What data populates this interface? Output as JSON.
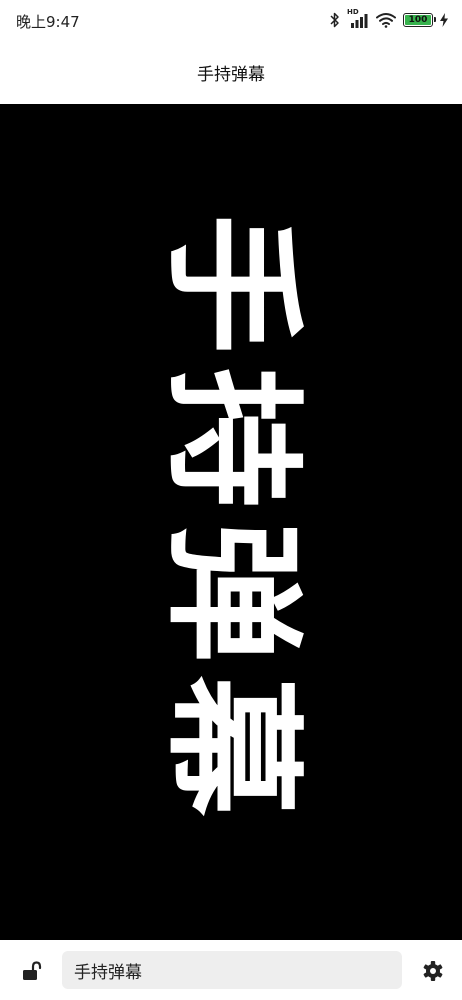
{
  "status_bar": {
    "time": "晚上9:47",
    "network_label": "HD",
    "battery_level": 100,
    "battery_text": "100",
    "battery_color": "#37b24d",
    "icons": [
      "bluetooth-icon",
      "signal-icon",
      "wifi-icon",
      "battery-icon",
      "charging-icon"
    ]
  },
  "header": {
    "title": "手持弹幕"
  },
  "marquee": {
    "text": "手持弹幕",
    "background": "#000000",
    "text_color": "#ffffff",
    "orientation": "rotated-90"
  },
  "bottom_bar": {
    "lock_icon": "unlock-icon",
    "input_value": "手持弹幕",
    "settings_icon": "gear-icon"
  }
}
